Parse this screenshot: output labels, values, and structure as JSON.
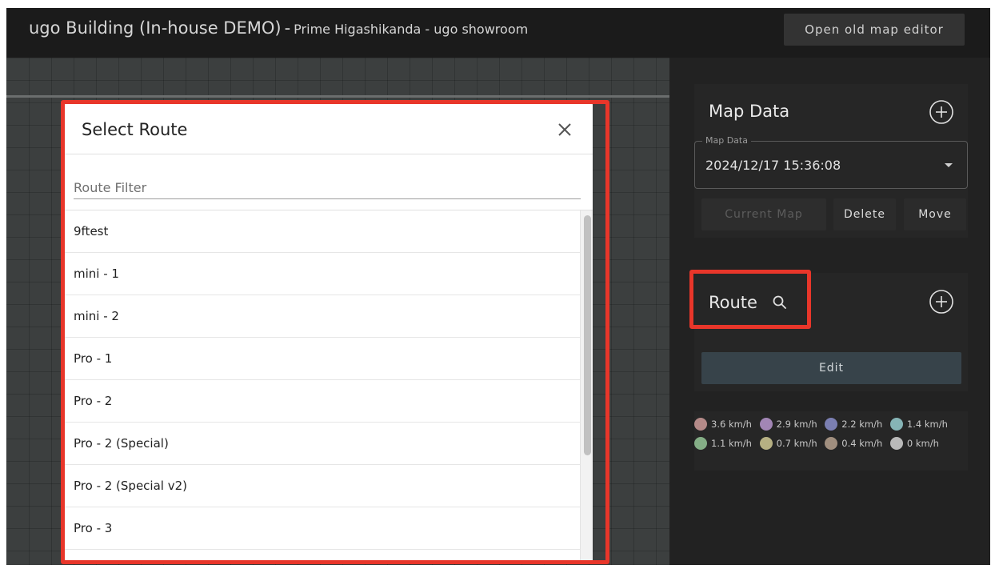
{
  "header": {
    "building": "ugo Building (In-house DEMO)",
    "separator": "-",
    "location": "Prime Higashikanda - ugo showroom",
    "open_old_editor_label": "Open old map editor"
  },
  "modal": {
    "title": "Select Route",
    "filter_placeholder": "Route Filter",
    "routes": [
      "9ftest",
      "mini - 1",
      "mini - 2",
      "Pro - 1",
      "Pro - 2",
      "Pro - 2 (Special)",
      "Pro - 2 (Special v2)",
      "Pro - 3"
    ]
  },
  "map_data_panel": {
    "title": "Map Data",
    "select_label": "Map Data",
    "selected_value": "2024/12/17 15:36:08",
    "current_map_label": "Current Map",
    "delete_label": "Delete",
    "move_label": "Move"
  },
  "route_panel": {
    "title": "Route",
    "edit_label": "Edit"
  },
  "speed_legend": [
    {
      "label": "3.6 km/h",
      "color": "#b48a88"
    },
    {
      "label": "2.9 km/h",
      "color": "#a286b5"
    },
    {
      "label": "2.2 km/h",
      "color": "#7b7fb2"
    },
    {
      "label": "1.4 km/h",
      "color": "#86b4b6"
    },
    {
      "label": "1.1 km/h",
      "color": "#84ae86"
    },
    {
      "label": "0.7 km/h",
      "color": "#b6b083"
    },
    {
      "label": "0.4 km/h",
      "color": "#a18f7f"
    },
    {
      "label": "0 km/h",
      "color": "#b9b9b9"
    }
  ]
}
